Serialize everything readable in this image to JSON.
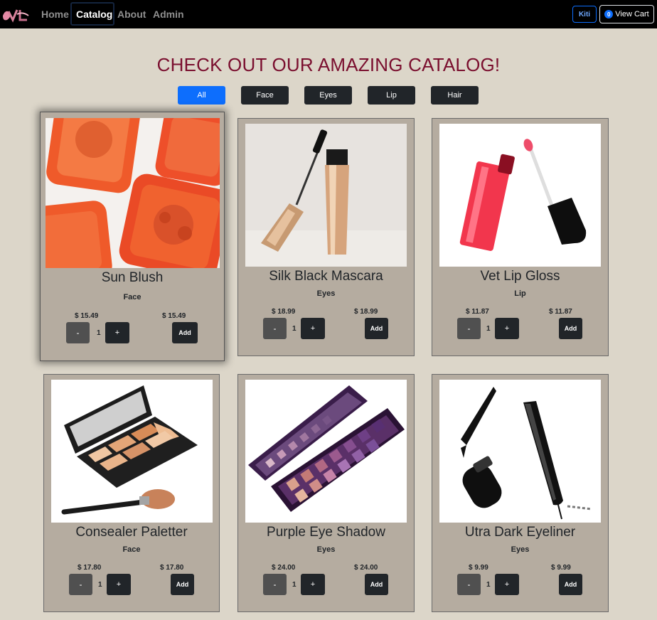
{
  "nav": {
    "links": [
      "Home",
      "Catalog",
      "About",
      "Admin"
    ],
    "active": "Catalog",
    "user_label": "Kiti",
    "cart_count": "0",
    "cart_label": "View Cart"
  },
  "heading": "CHECK OUT OUR AMAZING CATALOG!",
  "filters": [
    "All",
    "Face",
    "Eyes",
    "Lip",
    "Hair"
  ],
  "selected_filter": "All",
  "products": [
    {
      "name": "Sun Blush",
      "category": "Face",
      "price": "$ 15.49",
      "total": "$ 15.49",
      "qty": "1",
      "image": "orange-blush-compacts"
    },
    {
      "name": "Silk Black Mascara",
      "category": "Eyes",
      "price": "$ 18.99",
      "total": "$ 18.99",
      "qty": "1",
      "image": "gold-mascara-tube"
    },
    {
      "name": "Vet Lip Gloss",
      "category": "Lip",
      "price": "$ 11.87",
      "total": "$ 11.87",
      "qty": "1",
      "image": "red-lip-gloss"
    },
    {
      "name": "Consealer Paletter",
      "category": "Face",
      "price": "$ 17.80",
      "total": "$ 17.80",
      "qty": "1",
      "image": "concealer-palette-brush"
    },
    {
      "name": "Purple Eye Shadow",
      "category": "Eyes",
      "price": "$ 24.00",
      "total": "$ 24.00",
      "qty": "1",
      "image": "purple-eyeshadow-palette"
    },
    {
      "name": "Utra Dark Eyeliner",
      "category": "Eyes",
      "price": "$ 9.99",
      "total": "$ 9.99",
      "qty": "1",
      "image": "black-liquid-eyeliner"
    }
  ],
  "buttons": {
    "minus": "-",
    "plus": "+",
    "add": "Add"
  },
  "colors": {
    "nav_bg": "#000000",
    "page_bg": "#dcd6c9",
    "card_bg": "#b5aca0",
    "heading": "#7a0e2e",
    "primary": "#0d6efd",
    "dark_button": "#212529"
  }
}
